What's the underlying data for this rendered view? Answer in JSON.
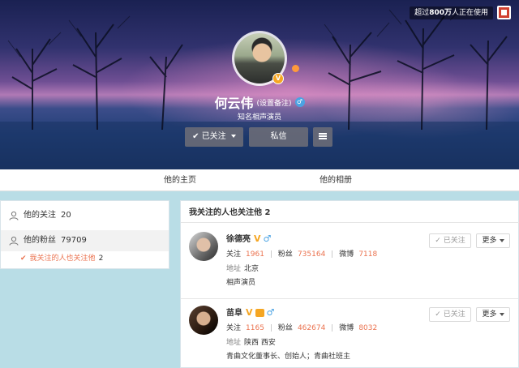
{
  "header": {
    "users_badge_prefix": "超过",
    "users_badge_number": "800万",
    "users_badge_suffix": "人正在使用",
    "v_badge": "V"
  },
  "profile": {
    "name": "何云伟",
    "remark": "(设置备注)",
    "gender_symbol": "♂",
    "subtitle": "知名相声演员",
    "follow_button": "已关注",
    "follow_check": "✔",
    "message_button": "私信"
  },
  "tabs": {
    "home": "他的主页",
    "album": "他的相册"
  },
  "sidebar": {
    "following_label": "他的关注",
    "following_count": "20",
    "fans_label": "他的粉丝",
    "fans_count": "79709",
    "mutual_check": "✔",
    "mutual_label": "我关注的人也关注他",
    "mutual_count": "2"
  },
  "main": {
    "title": "我关注的人也关注他 2",
    "items": [
      {
        "name": "徐德亮",
        "v": "V",
        "gender": "♂",
        "follow_label": "关注",
        "follow_value": "1961",
        "fans_label": "粉丝",
        "fans_value": "735164",
        "weibo_label": "微博",
        "weibo_value": "7118",
        "addr_label": "地址",
        "addr_value": "北京",
        "desc": "相声演员",
        "btn_followed": "✓ 已关注",
        "btn_more": "更多"
      },
      {
        "name": "苗阜",
        "v": "V",
        "gender": "♂",
        "follow_label": "关注",
        "follow_value": "1165",
        "fans_label": "粉丝",
        "fans_value": "462674",
        "weibo_label": "微博",
        "weibo_value": "8032",
        "addr_label": "地址",
        "addr_value": "陕西 西安",
        "desc": "青曲文化董事长、创始人；青曲社班主",
        "btn_followed": "✓ 已关注",
        "btn_more": "更多"
      }
    ]
  },
  "colors": {
    "accent_orange": "#eb7350",
    "verified_gold": "#f5a623",
    "male_blue": "#4ba3e3",
    "page_background": "#b9dde6"
  },
  "icons": {
    "corner": "app-corner-icon",
    "follow_caret": "chevron-down-icon",
    "menu": "hamburger-icon",
    "person": "person-icon",
    "check": "check-icon"
  }
}
